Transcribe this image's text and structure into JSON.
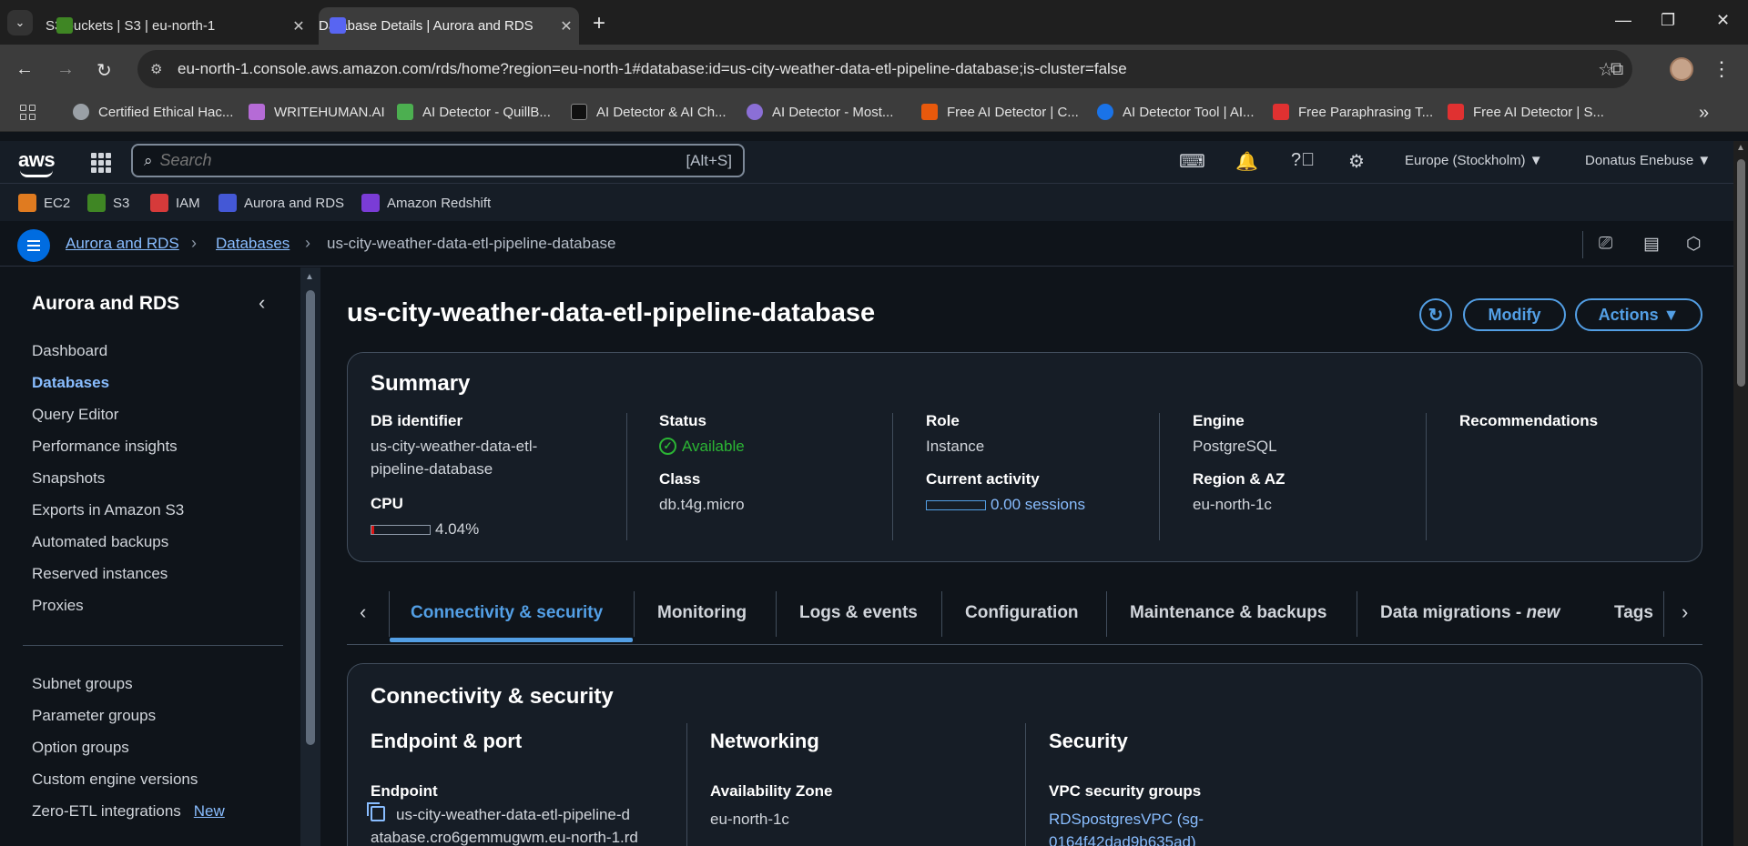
{
  "browser": {
    "tabs": [
      {
        "title": "S3 buckets | S3 | eu-north-1",
        "active": false
      },
      {
        "title": "Database Details | Aurora and RDS",
        "active": true
      }
    ],
    "url": "eu-north-1.console.aws.amazon.com/rds/home?region=eu-north-1#database:id=us-city-weather-data-etl-pipeline-database;is-cluster=false",
    "bookmarks": [
      "Certified Ethical Hac...",
      "WRITEHUMAN.AI",
      "AI Detector - QuillB...",
      "AI Detector & AI Ch...",
      "AI Detector - Most...",
      "Free AI Detector | C...",
      "AI Detector Tool | AI...",
      "Free Paraphrasing T...",
      "Free AI Detector | S..."
    ]
  },
  "aws": {
    "logo": "aws",
    "search_placeholder": "Search",
    "search_shortcut": "[Alt+S]",
    "region": "Europe (Stockholm) ▼",
    "user": "Donatus Enebuse ▼",
    "favorites": [
      "EC2",
      "S3",
      "IAM",
      "Aurora and RDS",
      "Amazon Redshift"
    ],
    "breadcrumb": [
      "Aurora and RDS",
      "Databases",
      "us-city-weather-data-etl-pipeline-database"
    ]
  },
  "sidebar": {
    "title": "Aurora and RDS",
    "items": [
      "Dashboard",
      "Databases",
      "Query Editor",
      "Performance insights",
      "Snapshots",
      "Exports in Amazon S3",
      "Automated backups",
      "Reserved instances",
      "Proxies"
    ],
    "items2": [
      "Subnet groups",
      "Parameter groups",
      "Option groups",
      "Custom engine versions",
      "Zero-ETL integrations"
    ],
    "new_badge": "New"
  },
  "page": {
    "title": "us-city-weather-data-etl-pipeline-database",
    "modify": "Modify",
    "actions": "Actions ▼"
  },
  "summary": {
    "heading": "Summary",
    "db_identifier_label": "DB identifier",
    "db_identifier": [
      "us-city-weather-data-etl-",
      "pipeline-database"
    ],
    "cpu_label": "CPU",
    "cpu_value": "4.04%",
    "cpu_percent": 4.04,
    "status_label": "Status",
    "status": "Available",
    "class_label": "Class",
    "class": "db.t4g.micro",
    "role_label": "Role",
    "role": "Instance",
    "activity_label": "Current activity",
    "activity": "0.00 sessions",
    "engine_label": "Engine",
    "engine": "PostgreSQL",
    "region_label": "Region & AZ",
    "region": "eu-north-1c",
    "recommendations_label": "Recommendations"
  },
  "tabs": [
    "Connectivity & security",
    "Monitoring",
    "Logs & events",
    "Configuration",
    "Maintenance & backups",
    "Data migrations - ",
    "new",
    "Tags"
  ],
  "connectivity": {
    "heading": "Connectivity & security",
    "endpoint_port": "Endpoint & port",
    "endpoint_label": "Endpoint",
    "endpoint": [
      "us-city-weather-data-etl-pipeline-d",
      "atabase.cro6gemmugwm.eu-north-1.rd"
    ],
    "networking": "Networking",
    "az_label": "Availability Zone",
    "az": "eu-north-1c",
    "security": "Security",
    "vpc_sg_label": "VPC security groups",
    "vpc_sg": [
      "RDSpostgresVPC (sg-",
      "0164f42dad9b635ad)"
    ]
  }
}
